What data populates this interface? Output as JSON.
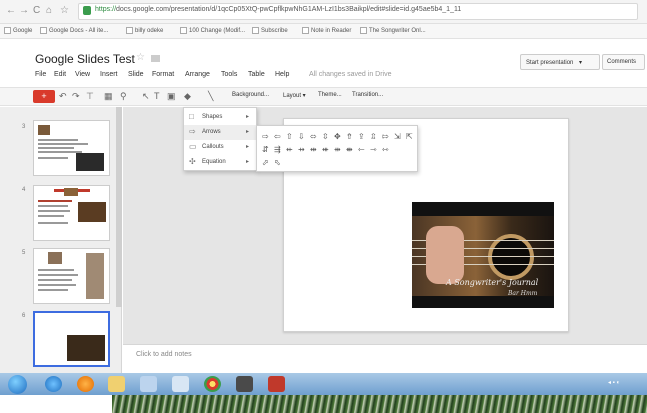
{
  "browser": {
    "url_https": "https://",
    "url_rest": "docs.google.com/presentation/d/1qcCp05XtQ-pwCpflkpwNhG1AM-LzI1bs3Baikpl/edit#slide=id.g45ae5b4_1_11",
    "bookmarks": [
      "Google",
      "Google Docs - All ite...",
      "billy odeke",
      "100 Change (Modif...",
      "Subscribe",
      "Note in Reader",
      "The Songwriter Onl..."
    ]
  },
  "doc": {
    "title": "Google Slides Test",
    "saved_status": "All changes saved in Drive",
    "menus": [
      "File",
      "Edit",
      "View",
      "Insert",
      "Slide",
      "Format",
      "Arrange",
      "Tools",
      "Table",
      "Help"
    ],
    "present_label": "Start presentation",
    "present_arrow": "▾",
    "comments_label": "Comments"
  },
  "toolbar": {
    "new_slide_label": "+",
    "background_label": "Background...",
    "layout_label": "Layout ▾",
    "theme_label": "Theme...",
    "transition_label": "Transition..."
  },
  "filmstrip": {
    "slide_numbers": [
      "3",
      "4",
      "5",
      "6"
    ]
  },
  "insert_menu": {
    "items": [
      {
        "label": "Shapes",
        "icon": "square-icon"
      },
      {
        "label": "Arrows",
        "icon": "arrow-icon"
      },
      {
        "label": "Callouts",
        "icon": "callout-icon"
      },
      {
        "label": "Equation",
        "icon": "plus-icon"
      }
    ],
    "arrow_glyphs": [
      "⇨",
      "⇦",
      "⇧",
      "⇩",
      "⬄",
      "⇳",
      "✥",
      "⇮",
      "⇪",
      "⇫",
      "⇰",
      "⇲",
      "⇱",
      "⇵",
      "⇶",
      "⇷",
      "⇸",
      "⇹",
      "⇺",
      "⇻",
      "⇼",
      "⇽",
      "⇾",
      "⇿",
      "⬀",
      "⬁"
    ]
  },
  "slide": {
    "photo_title": "A Songwriter's Journal",
    "photo_author": "Bar Hmm"
  },
  "notes": {
    "placeholder": "Click to add notes"
  },
  "colors": {
    "accent_red": "#d93a2b",
    "selection_blue": "#3d6ce0"
  }
}
